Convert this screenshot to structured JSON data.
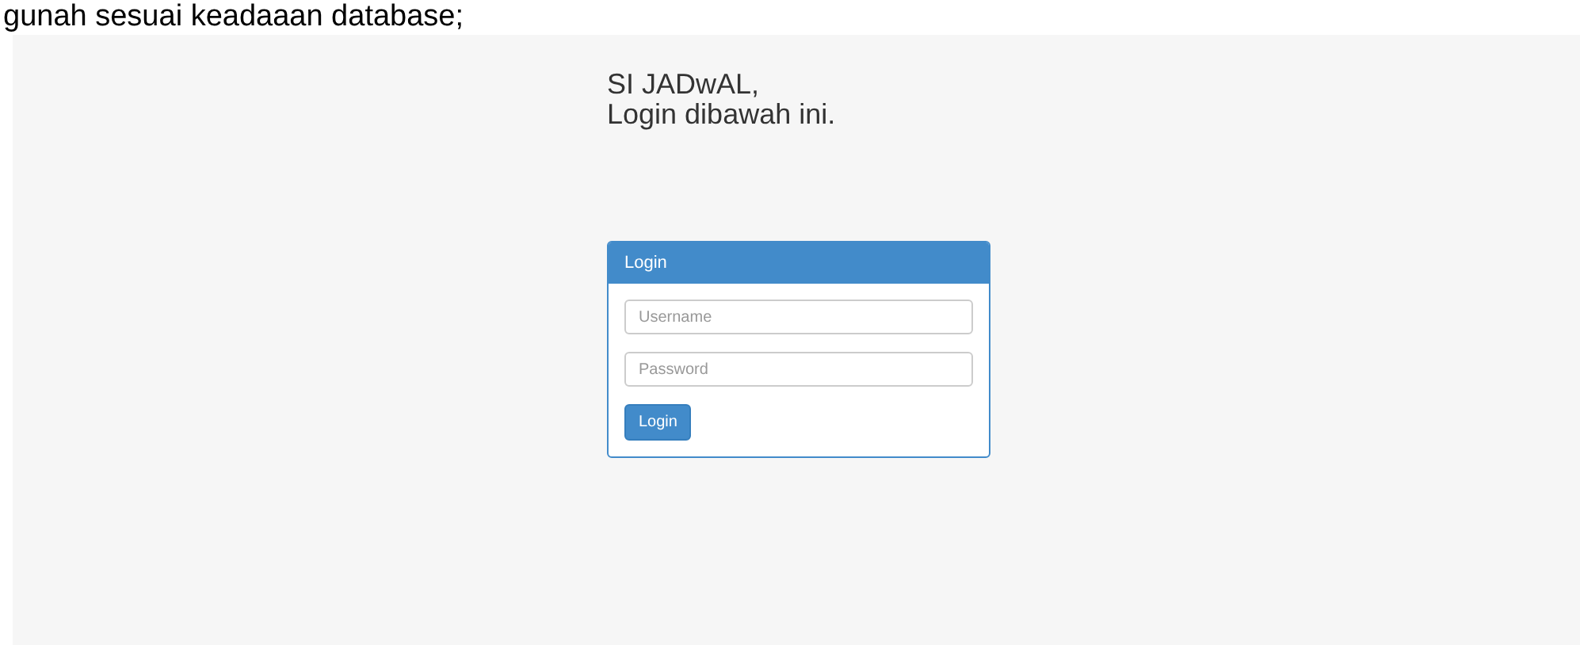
{
  "top_text": "gunah sesuai keadaaan database;",
  "heading": {
    "line_1": "SI JADwAL,",
    "line_2": "Login dibawah ini."
  },
  "panel": {
    "title": "Login",
    "username": {
      "placeholder": "Username"
    },
    "password": {
      "placeholder": "Password"
    },
    "button": "Login"
  }
}
